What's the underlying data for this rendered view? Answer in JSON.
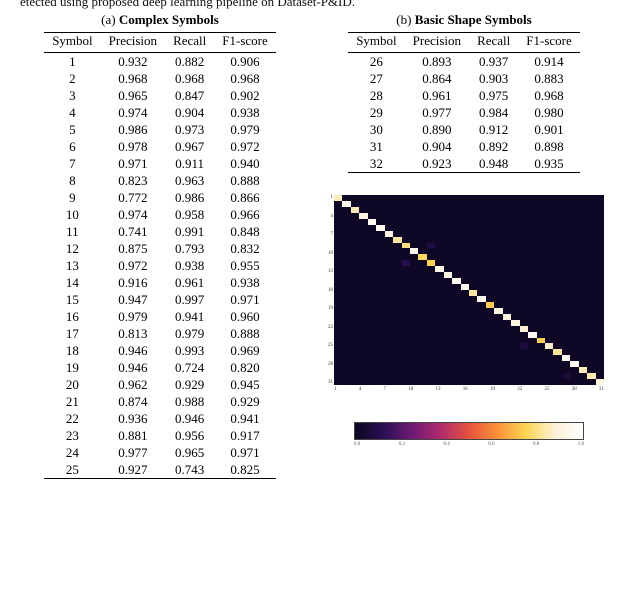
{
  "topline": "etected using proposed deep learning pipeline on Dataset-P&ID.",
  "captions": {
    "a_prefix": "(a) ",
    "a_bold": "Complex Symbols",
    "b_prefix": "(b) ",
    "b_bold": "Basic Shape Symbols"
  },
  "headers": {
    "symbol": "Symbol",
    "precision": "Precision",
    "recall": "Recall",
    "f1": "F1-score"
  },
  "table_a": [
    {
      "s": "1",
      "p": "0.932",
      "r": "0.882",
      "f": "0.906"
    },
    {
      "s": "2",
      "p": "0.968",
      "r": "0.968",
      "f": "0.968"
    },
    {
      "s": "3",
      "p": "0.965",
      "r": "0.847",
      "f": "0.902"
    },
    {
      "s": "4",
      "p": "0.974",
      "r": "0.904",
      "f": "0.938"
    },
    {
      "s": "5",
      "p": "0.986",
      "r": "0.973",
      "f": "0.979"
    },
    {
      "s": "6",
      "p": "0.978",
      "r": "0.967",
      "f": "0.972"
    },
    {
      "s": "7",
      "p": "0.971",
      "r": "0.911",
      "f": "0.940"
    },
    {
      "s": "8",
      "p": "0.823",
      "r": "0.963",
      "f": "0.888"
    },
    {
      "s": "9",
      "p": "0.772",
      "r": "0.986",
      "f": "0.866"
    },
    {
      "s": "10",
      "p": "0.974",
      "r": "0.958",
      "f": "0.966"
    },
    {
      "s": "11",
      "p": "0.741",
      "r": "0.991",
      "f": "0.848"
    },
    {
      "s": "12",
      "p": "0.875",
      "r": "0.793",
      "f": "0.832"
    },
    {
      "s": "13",
      "p": "0.972",
      "r": "0.938",
      "f": "0.955"
    },
    {
      "s": "14",
      "p": "0.916",
      "r": "0.961",
      "f": "0.938"
    },
    {
      "s": "15",
      "p": "0.947",
      "r": "0.997",
      "f": "0.971"
    },
    {
      "s": "16",
      "p": "0.979",
      "r": "0.941",
      "f": "0.960"
    },
    {
      "s": "17",
      "p": "0.813",
      "r": "0.979",
      "f": "0.888"
    },
    {
      "s": "18",
      "p": "0.946",
      "r": "0.993",
      "f": "0.969"
    },
    {
      "s": "19",
      "p": "0.946",
      "r": "0.724",
      "f": "0.820"
    },
    {
      "s": "20",
      "p": "0.962",
      "r": "0.929",
      "f": "0.945"
    },
    {
      "s": "21",
      "p": "0.874",
      "r": "0.988",
      "f": "0.929"
    },
    {
      "s": "22",
      "p": "0.936",
      "r": "0.946",
      "f": "0.941"
    },
    {
      "s": "23",
      "p": "0.881",
      "r": "0.956",
      "f": "0.917"
    },
    {
      "s": "24",
      "p": "0.977",
      "r": "0.965",
      "f": "0.971"
    },
    {
      "s": "25",
      "p": "0.927",
      "r": "0.743",
      "f": "0.825"
    }
  ],
  "table_b": [
    {
      "s": "26",
      "p": "0.893",
      "r": "0.937",
      "f": "0.914"
    },
    {
      "s": "27",
      "p": "0.864",
      "r": "0.903",
      "f": "0.883"
    },
    {
      "s": "28",
      "p": "0.961",
      "r": "0.975",
      "f": "0.968"
    },
    {
      "s": "29",
      "p": "0.977",
      "r": "0.984",
      "f": "0.980"
    },
    {
      "s": "30",
      "p": "0.890",
      "r": "0.912",
      "f": "0.901"
    },
    {
      "s": "31",
      "p": "0.904",
      "r": "0.892",
      "f": "0.898"
    },
    {
      "s": "32",
      "p": "0.923",
      "r": "0.948",
      "f": "0.935"
    }
  ],
  "chart_data": {
    "type": "heatmap",
    "title": "",
    "size": 32,
    "diag_values": [
      0.906,
      0.968,
      0.902,
      0.938,
      0.979,
      0.972,
      0.94,
      0.888,
      0.866,
      0.966,
      0.848,
      0.832,
      0.955,
      0.938,
      0.971,
      0.96,
      0.888,
      0.969,
      0.82,
      0.945,
      0.929,
      0.941,
      0.917,
      0.971,
      0.825,
      0.914,
      0.883,
      0.968,
      0.98,
      0.901,
      0.898,
      0.935
    ],
    "off_diag_hotspots": [
      {
        "r": 11,
        "c": 8,
        "v": 0.12
      },
      {
        "r": 8,
        "c": 11,
        "v": 0.1
      },
      {
        "r": 25,
        "c": 22,
        "v": 0.08
      },
      {
        "r": 30,
        "c": 27,
        "v": 0.07
      }
    ],
    "x_ticks": [
      "1",
      "4",
      "7",
      "10",
      "13",
      "16",
      "19",
      "22",
      "25",
      "28",
      "31"
    ],
    "y_ticks": [
      "1",
      "4",
      "7",
      "10",
      "13",
      "16",
      "19",
      "22",
      "25",
      "28",
      "31"
    ],
    "colorbar_ticks": [
      "0.0",
      "0.2",
      "0.4",
      "0.6",
      "0.8",
      "1.0"
    ]
  },
  "colormap": [
    {
      "v": 0.0,
      "c": "#0c0722"
    },
    {
      "v": 0.14,
      "c": "#2a0f54"
    },
    {
      "v": 0.3,
      "c": "#701a75"
    },
    {
      "v": 0.45,
      "c": "#b02a6e"
    },
    {
      "v": 0.6,
      "c": "#e5533d"
    },
    {
      "v": 0.72,
      "c": "#f99139"
    },
    {
      "v": 0.84,
      "c": "#fcd551"
    },
    {
      "v": 0.92,
      "c": "#fdf0d5"
    },
    {
      "v": 1.0,
      "c": "#ffffff"
    }
  ]
}
